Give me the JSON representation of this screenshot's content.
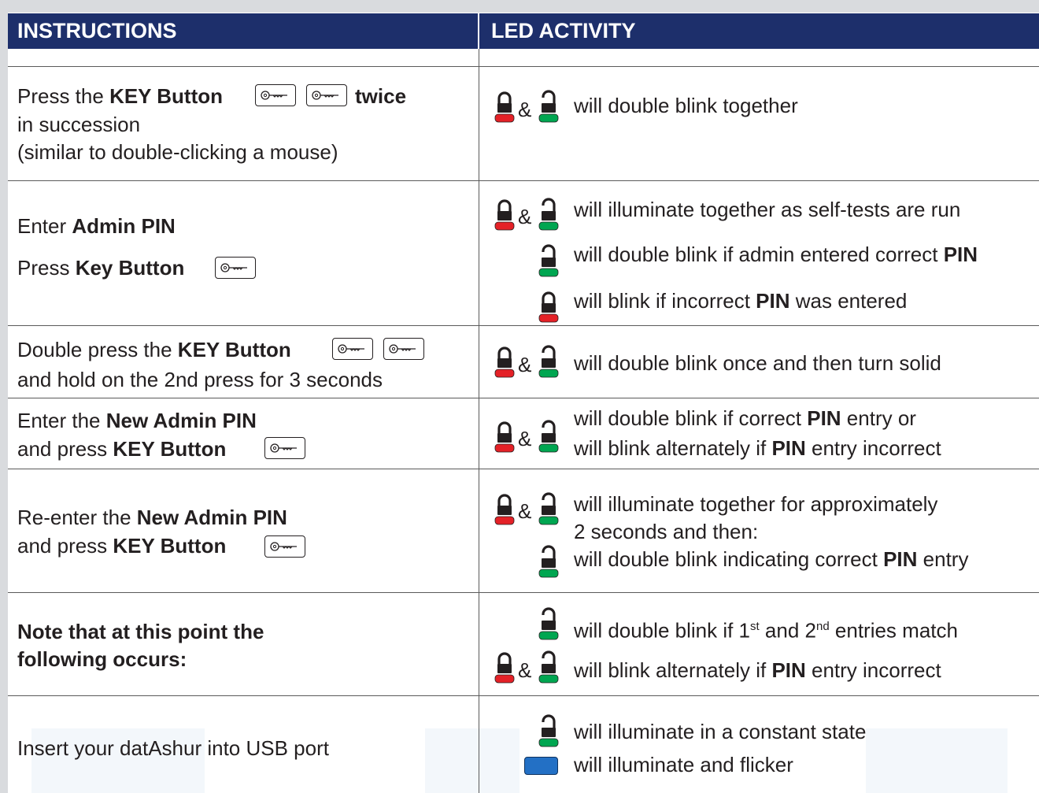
{
  "header": {
    "instructions_title": "INSTRUCTIONS",
    "led_title": "LED ACTIVITY",
    "background_color": "#1d2f6b"
  },
  "colors": {
    "red_led": "#e42127",
    "green_led": "#00a651",
    "blue_led": "#2370c5"
  },
  "icons": {
    "key_button": "key-icon",
    "locked": "red-padlock-locked-icon",
    "unlocked": "green-padlock-unlocked-icon",
    "blue_led": "blue-led-icon"
  },
  "rows": [
    {
      "instruction": {
        "press": "Press the ",
        "key_button": "KEY Button",
        "twice": "twice",
        "line2": "in succession",
        "line3": "(similar to double-clicking a mouse)"
      },
      "amp": "&",
      "led": {
        "line1": "will double blink together"
      }
    },
    {
      "instruction": {
        "enter": "Enter ",
        "admin_pin": "Admin PIN",
        "press": "Press ",
        "key_button": "Key Button"
      },
      "amp": "&",
      "led": {
        "line1": "will illuminate together as self-tests are run",
        "line2_pre": "will double blink if admin entered correct ",
        "line2_bold": "PIN",
        "line3_pre": "will blink if incorrect ",
        "line3_bold": "PIN",
        "line3_post": " was entered"
      }
    },
    {
      "instruction": {
        "pre": "Double press the ",
        "key_button": "KEY Button",
        "line2": "and hold on the 2nd press for 3 seconds"
      },
      "amp": "&",
      "led": {
        "line1": "will double blink once and then turn solid"
      }
    },
    {
      "instruction": {
        "pre": "Enter the ",
        "bold": "New Admin PIN",
        "line2_pre": "and press ",
        "key_button": "KEY Button"
      },
      "amp": "&",
      "led": {
        "line1_pre": "will double blink if correct ",
        "line1_bold": "PIN",
        "line1_post": " entry or",
        "line2_pre": "will blink alternately if ",
        "line2_bold": "PIN",
        "line2_post": " entry incorrect"
      }
    },
    {
      "instruction": {
        "pre": "Re-enter the ",
        "bold": "New Admin PIN",
        "line2_pre": "and press ",
        "key_button": "KEY Button"
      },
      "amp": "&",
      "led": {
        "line1": "will illuminate together for approximately",
        "line2": "2 seconds and then:",
        "line3_pre": "will double blink indicating correct ",
        "line3_bold": "PIN",
        "line3_post": " entry"
      }
    },
    {
      "instruction": {
        "line1": "Note that at this point the",
        "line2": "following occurs:"
      },
      "amp": "&",
      "led": {
        "line1_pre": "will double blink if 1",
        "line1_sup1": "st",
        "line1_mid": " and 2",
        "line1_sup2": "nd",
        "line1_post": " entries match",
        "line2_pre": "will blink alternately if ",
        "line2_bold": "PIN",
        "line2_post": " entry incorrect"
      }
    },
    {
      "instruction": {
        "line1": "Insert your datAshur into USB port"
      },
      "led": {
        "line1": "will illuminate in a constant state",
        "line2": "will illuminate and flicker"
      }
    }
  ]
}
